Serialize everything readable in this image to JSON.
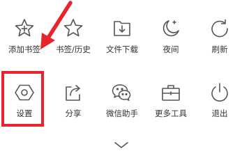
{
  "menu": {
    "row1": [
      {
        "label": "添加书签",
        "icon": "star-plus-icon"
      },
      {
        "label": "书签/历史",
        "icon": "star-icon"
      },
      {
        "label": "文件下载",
        "icon": "download-folder-icon"
      },
      {
        "label": "夜间",
        "icon": "moon-icon"
      },
      {
        "label": "刷新",
        "icon": "refresh-icon"
      }
    ],
    "row2": [
      {
        "label": "设置",
        "icon": "hexagon-settings-icon"
      },
      {
        "label": "分享",
        "icon": "share-icon"
      },
      {
        "label": "微信助手",
        "icon": "wechat-icon"
      },
      {
        "label": "更多工具",
        "icon": "toolbox-icon"
      },
      {
        "label": "退出",
        "icon": "power-icon"
      }
    ]
  },
  "collapse_icon": "chevron-down-icon",
  "annotation": {
    "highlight_color": "#e8232b",
    "arrow_color": "#e8232b"
  },
  "colors": {
    "icon_stroke": "#555555",
    "label_text": "#333333",
    "background": "#ffffff"
  }
}
